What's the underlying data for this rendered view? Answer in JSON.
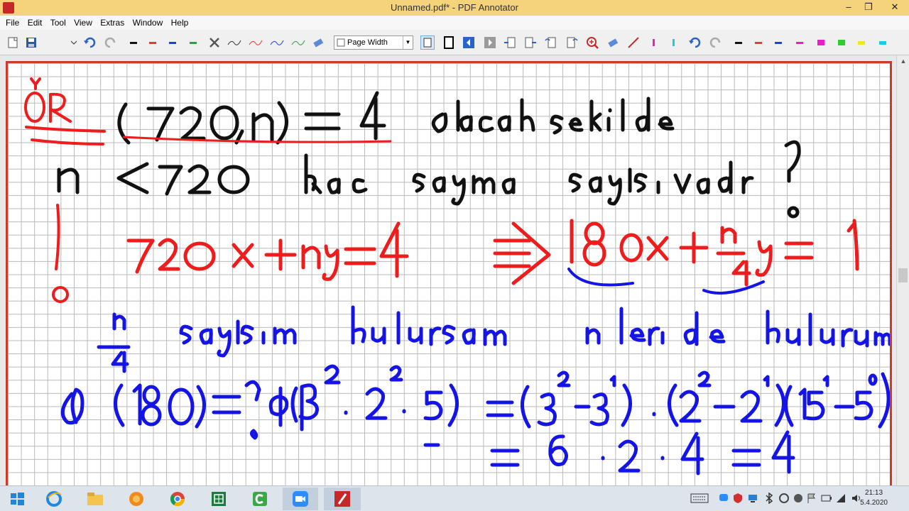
{
  "window": {
    "title": "Unnamed.pdf* - PDF Annotator",
    "controls": {
      "minimize": "–",
      "restore": "❐",
      "close": "✕"
    }
  },
  "menu": [
    "File",
    "Edit",
    "Tool",
    "View",
    "Extras",
    "Window",
    "Help"
  ],
  "toolbar": {
    "zoom_select": "Page Width",
    "pen_colors_left": [
      "#111111",
      "#e53935",
      "#1e40e0",
      "#2e9e3e"
    ],
    "pen_colors_right": [
      "#111111",
      "#e53935",
      "#1e40e0",
      "#e91ec8",
      "#2ecc2e",
      "#f2e61e",
      "#1ec8f0"
    ]
  },
  "document": {
    "accent_red": "#ee1c1c",
    "accent_blue": "#1414e6",
    "ink_black": "#111111"
  },
  "taskbar": {
    "apps": [
      "start-icon",
      "ie-icon",
      "explorer-icon",
      "firefox-icon",
      "chrome-icon",
      "excel-icon",
      "camtasia-icon",
      "zoom-icon",
      "pdf-annotator-icon"
    ],
    "time": "21:13",
    "date": "5.4.2020"
  }
}
